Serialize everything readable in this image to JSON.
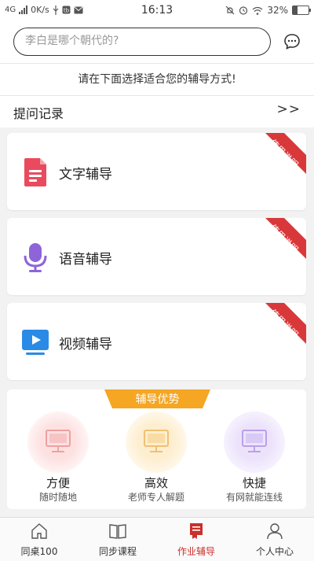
{
  "status_bar": {
    "network": "4G",
    "speed": "0K/s",
    "time": "16:13",
    "battery": "32%",
    "battery_level": 0.32
  },
  "search": {
    "placeholder": "李白是哪个朝代的?"
  },
  "hint_text": "请在下面选择适合您的辅导方式!",
  "history": {
    "label": "提问记录",
    "arrow": ">>"
  },
  "cards": [
    {
      "label": "文字辅导",
      "ribbon": "使用说明",
      "icon": "document-icon"
    },
    {
      "label": "语音辅导",
      "ribbon": "使用说明",
      "icon": "microphone-icon"
    },
    {
      "label": "视频辅导",
      "ribbon": "使用说明",
      "icon": "video-play-icon"
    }
  ],
  "advantages": {
    "title": "辅导优势",
    "items": [
      {
        "name": "方便",
        "desc": "随时随地",
        "color": "#f26b6b"
      },
      {
        "name": "高效",
        "desc": "老师专人解题",
        "color": "#f2b24b"
      },
      {
        "name": "快捷",
        "desc": "有网就能连线",
        "color": "#9a7be0"
      }
    ]
  },
  "bottom_nav": [
    {
      "label": "同桌100",
      "icon": "home-icon",
      "active": false
    },
    {
      "label": "同步课程",
      "icon": "book-icon",
      "active": false
    },
    {
      "label": "作业辅导",
      "icon": "homework-icon",
      "active": true
    },
    {
      "label": "个人中心",
      "icon": "user-icon",
      "active": false
    }
  ],
  "colors": {
    "accent": "#c9302c",
    "ribbon": "#d9383a",
    "tab_orange": "#f5a623"
  }
}
